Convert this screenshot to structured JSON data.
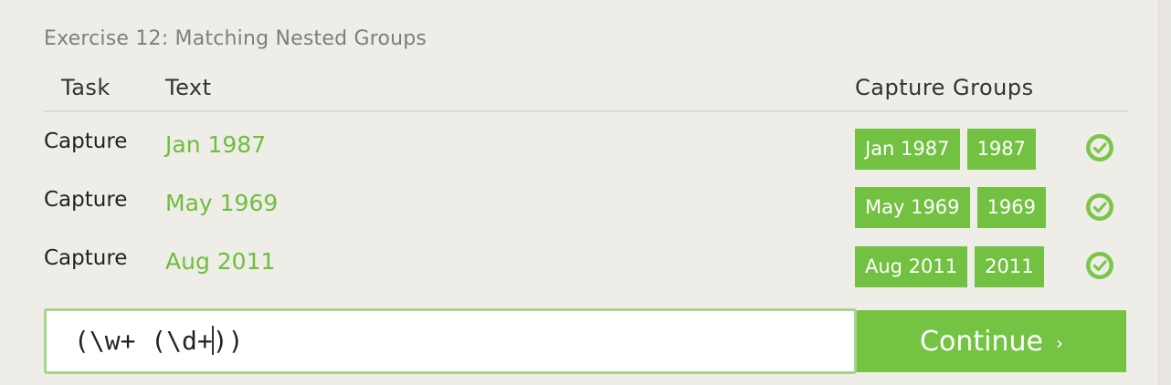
{
  "exercise": {
    "title": "Exercise 12: Matching Nested Groups"
  },
  "table": {
    "headers": {
      "task": "Task",
      "text": "Text",
      "capture_groups": "Capture Groups"
    },
    "rows": [
      {
        "task": "Capture",
        "text": "Jan 1987",
        "groups": [
          "Jan 1987",
          "1987"
        ],
        "status": "check-circle-icon"
      },
      {
        "task": "Capture",
        "text": "May 1969",
        "groups": [
          "May 1969",
          "1969"
        ],
        "status": "check-circle-icon"
      },
      {
        "task": "Capture",
        "text": "Aug 2011",
        "groups": [
          "Aug 2011",
          "2011"
        ],
        "status": "check-circle-icon"
      }
    ]
  },
  "input": {
    "value_before_caret": "(\\w+ (\\d+",
    "value_after_caret": "))"
  },
  "continue": {
    "label": "Continue",
    "icon": "chevron-right-icon",
    "chevron": "›"
  },
  "colors": {
    "accent_green": "#74c342",
    "text_green": "#6fbe3c",
    "input_border": "#a8d48b"
  }
}
